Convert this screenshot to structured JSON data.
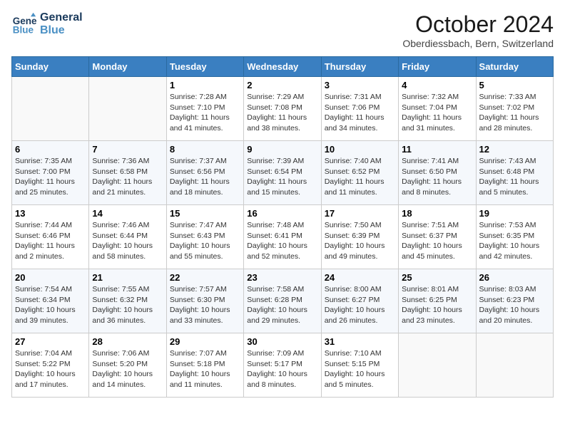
{
  "header": {
    "logo_line1": "General",
    "logo_line2": "Blue",
    "month": "October 2024",
    "location": "Oberdiessbach, Bern, Switzerland"
  },
  "weekdays": [
    "Sunday",
    "Monday",
    "Tuesday",
    "Wednesday",
    "Thursday",
    "Friday",
    "Saturday"
  ],
  "weeks": [
    [
      {
        "day": "",
        "info": ""
      },
      {
        "day": "",
        "info": ""
      },
      {
        "day": "1",
        "info": "Sunrise: 7:28 AM\nSunset: 7:10 PM\nDaylight: 11 hours and 41 minutes."
      },
      {
        "day": "2",
        "info": "Sunrise: 7:29 AM\nSunset: 7:08 PM\nDaylight: 11 hours and 38 minutes."
      },
      {
        "day": "3",
        "info": "Sunrise: 7:31 AM\nSunset: 7:06 PM\nDaylight: 11 hours and 34 minutes."
      },
      {
        "day": "4",
        "info": "Sunrise: 7:32 AM\nSunset: 7:04 PM\nDaylight: 11 hours and 31 minutes."
      },
      {
        "day": "5",
        "info": "Sunrise: 7:33 AM\nSunset: 7:02 PM\nDaylight: 11 hours and 28 minutes."
      }
    ],
    [
      {
        "day": "6",
        "info": "Sunrise: 7:35 AM\nSunset: 7:00 PM\nDaylight: 11 hours and 25 minutes."
      },
      {
        "day": "7",
        "info": "Sunrise: 7:36 AM\nSunset: 6:58 PM\nDaylight: 11 hours and 21 minutes."
      },
      {
        "day": "8",
        "info": "Sunrise: 7:37 AM\nSunset: 6:56 PM\nDaylight: 11 hours and 18 minutes."
      },
      {
        "day": "9",
        "info": "Sunrise: 7:39 AM\nSunset: 6:54 PM\nDaylight: 11 hours and 15 minutes."
      },
      {
        "day": "10",
        "info": "Sunrise: 7:40 AM\nSunset: 6:52 PM\nDaylight: 11 hours and 11 minutes."
      },
      {
        "day": "11",
        "info": "Sunrise: 7:41 AM\nSunset: 6:50 PM\nDaylight: 11 hours and 8 minutes."
      },
      {
        "day": "12",
        "info": "Sunrise: 7:43 AM\nSunset: 6:48 PM\nDaylight: 11 hours and 5 minutes."
      }
    ],
    [
      {
        "day": "13",
        "info": "Sunrise: 7:44 AM\nSunset: 6:46 PM\nDaylight: 11 hours and 2 minutes."
      },
      {
        "day": "14",
        "info": "Sunrise: 7:46 AM\nSunset: 6:44 PM\nDaylight: 10 hours and 58 minutes."
      },
      {
        "day": "15",
        "info": "Sunrise: 7:47 AM\nSunset: 6:43 PM\nDaylight: 10 hours and 55 minutes."
      },
      {
        "day": "16",
        "info": "Sunrise: 7:48 AM\nSunset: 6:41 PM\nDaylight: 10 hours and 52 minutes."
      },
      {
        "day": "17",
        "info": "Sunrise: 7:50 AM\nSunset: 6:39 PM\nDaylight: 10 hours and 49 minutes."
      },
      {
        "day": "18",
        "info": "Sunrise: 7:51 AM\nSunset: 6:37 PM\nDaylight: 10 hours and 45 minutes."
      },
      {
        "day": "19",
        "info": "Sunrise: 7:53 AM\nSunset: 6:35 PM\nDaylight: 10 hours and 42 minutes."
      }
    ],
    [
      {
        "day": "20",
        "info": "Sunrise: 7:54 AM\nSunset: 6:34 PM\nDaylight: 10 hours and 39 minutes."
      },
      {
        "day": "21",
        "info": "Sunrise: 7:55 AM\nSunset: 6:32 PM\nDaylight: 10 hours and 36 minutes."
      },
      {
        "day": "22",
        "info": "Sunrise: 7:57 AM\nSunset: 6:30 PM\nDaylight: 10 hours and 33 minutes."
      },
      {
        "day": "23",
        "info": "Sunrise: 7:58 AM\nSunset: 6:28 PM\nDaylight: 10 hours and 29 minutes."
      },
      {
        "day": "24",
        "info": "Sunrise: 8:00 AM\nSunset: 6:27 PM\nDaylight: 10 hours and 26 minutes."
      },
      {
        "day": "25",
        "info": "Sunrise: 8:01 AM\nSunset: 6:25 PM\nDaylight: 10 hours and 23 minutes."
      },
      {
        "day": "26",
        "info": "Sunrise: 8:03 AM\nSunset: 6:23 PM\nDaylight: 10 hours and 20 minutes."
      }
    ],
    [
      {
        "day": "27",
        "info": "Sunrise: 7:04 AM\nSunset: 5:22 PM\nDaylight: 10 hours and 17 minutes."
      },
      {
        "day": "28",
        "info": "Sunrise: 7:06 AM\nSunset: 5:20 PM\nDaylight: 10 hours and 14 minutes."
      },
      {
        "day": "29",
        "info": "Sunrise: 7:07 AM\nSunset: 5:18 PM\nDaylight: 10 hours and 11 minutes."
      },
      {
        "day": "30",
        "info": "Sunrise: 7:09 AM\nSunset: 5:17 PM\nDaylight: 10 hours and 8 minutes."
      },
      {
        "day": "31",
        "info": "Sunrise: 7:10 AM\nSunset: 5:15 PM\nDaylight: 10 hours and 5 minutes."
      },
      {
        "day": "",
        "info": ""
      },
      {
        "day": "",
        "info": ""
      }
    ]
  ]
}
